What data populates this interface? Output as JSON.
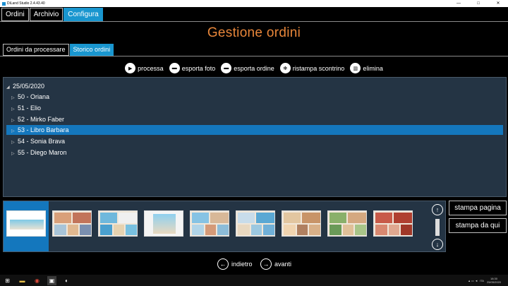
{
  "window": {
    "title": "DiLand Studio 2.4.43.40",
    "minimize": "—",
    "maximize": "□",
    "close": "✕"
  },
  "top_tabs": [
    {
      "label": "Ordini",
      "active": false
    },
    {
      "label": "Archivio",
      "active": false
    },
    {
      "label": "Configura",
      "active": true
    }
  ],
  "page_title": "Gestione ordini",
  "sub_tabs": [
    {
      "label": "Ordini da processare",
      "active": false
    },
    {
      "label": "Storico ordini",
      "active": true
    }
  ],
  "toolbar": [
    {
      "label": "processa",
      "icon": "play-icon"
    },
    {
      "label": "esporta foto",
      "icon": "folder-icon"
    },
    {
      "label": "esporta ordine",
      "icon": "folder-icon"
    },
    {
      "label": "ristampa scontrino",
      "icon": "gear-icon"
    },
    {
      "label": "elimina",
      "icon": "trash-icon"
    }
  ],
  "tree": {
    "root": "25/05/2020",
    "items": [
      {
        "label": "50 - Oriana",
        "selected": false
      },
      {
        "label": "51 - Elio",
        "selected": false
      },
      {
        "label": "52 - Mirko Faber",
        "selected": false
      },
      {
        "label": "53 - Libro Barbara",
        "selected": true
      },
      {
        "label": "54 - Sonia Brava",
        "selected": false
      },
      {
        "label": "55 - Diego Maron",
        "selected": false
      }
    ]
  },
  "side_buttons": {
    "print_page": "stampa pagina",
    "print_from_here": "stampa da qui"
  },
  "nav": {
    "back": "indietro",
    "forward": "avanti"
  },
  "taskbar": {
    "time": "18:30",
    "date": "25/05/2020",
    "lang": "ITA"
  },
  "colors": {
    "accent": "#1996cf",
    "title": "#e8863a",
    "panel": "#243444",
    "selected": "#1477bd"
  }
}
